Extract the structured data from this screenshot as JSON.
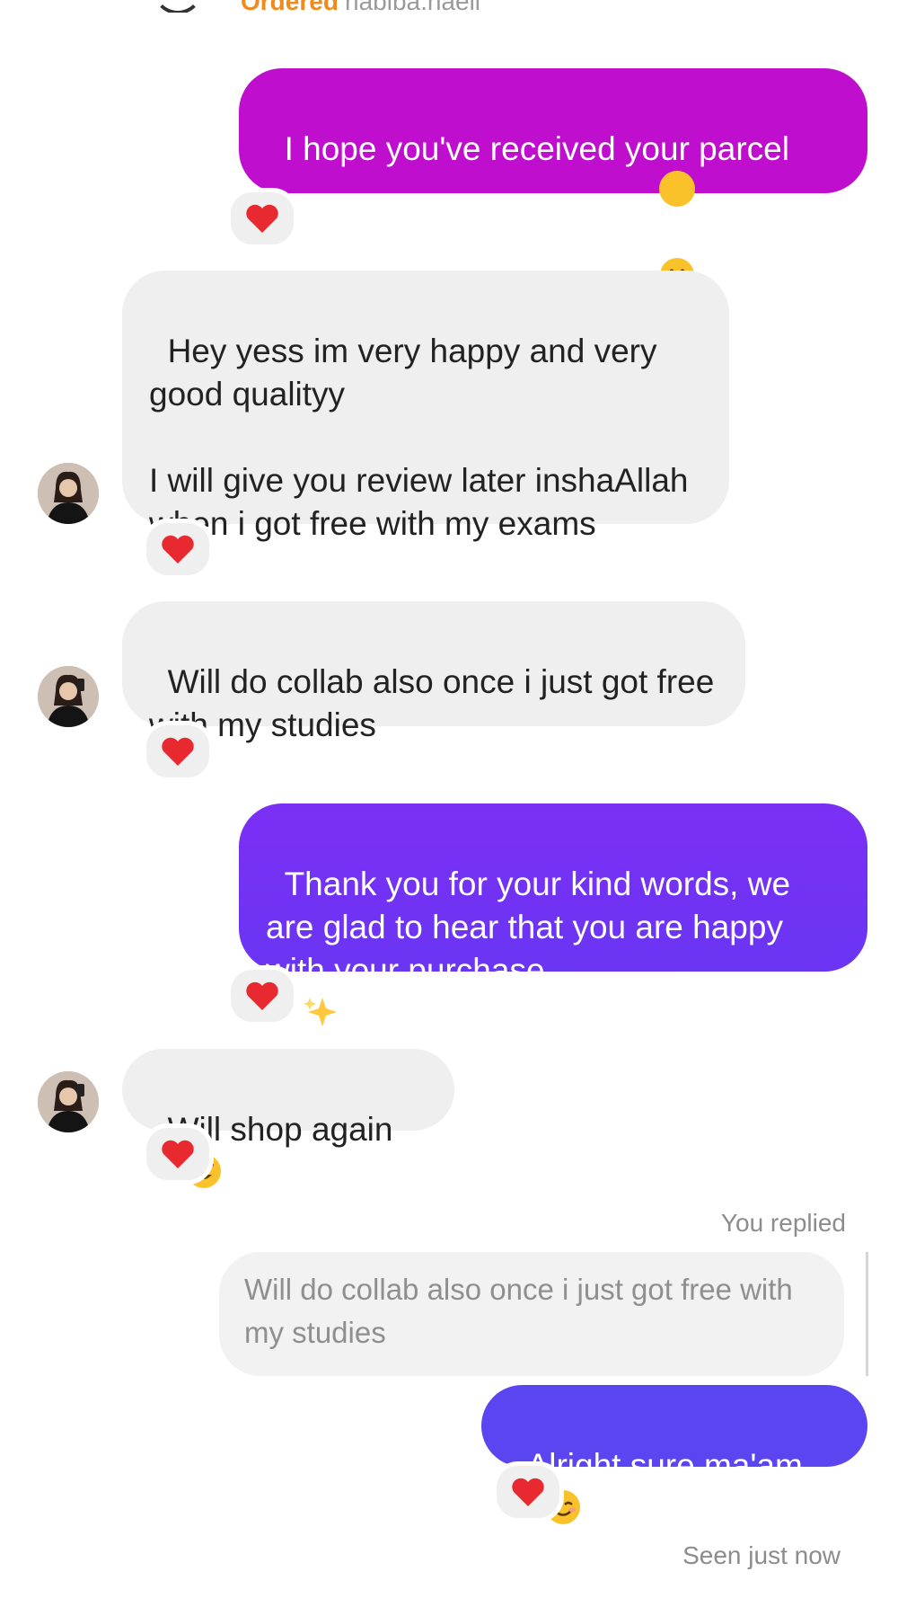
{
  "top": {
    "orange_label": "Ordered",
    "gray_label": "habiba.haeli"
  },
  "messages": [
    {
      "sender": "me",
      "text": "I hope you've received your parcel and happy with the quality!",
      "emoji": "🙂",
      "reaction": "heart"
    },
    {
      "sender": "them",
      "text": "Hey yess im very happy and very good qualityy\n\nI will give you review later inshaAllah when i got free with my exams",
      "reaction": "heart"
    },
    {
      "sender": "them",
      "text": "Will do collab also once i just got free with my studies",
      "reaction": "heart"
    },
    {
      "sender": "me",
      "text": "Thank you for your kind words, we are glad to hear that you are happy with your purchase",
      "emoji": "✨",
      "reaction": "heart"
    },
    {
      "sender": "them",
      "text": "Will shop again",
      "emoji": "😍",
      "reaction": "heart"
    },
    {
      "sender": "me",
      "text": "Alright sure ma'am",
      "emoji": "😊",
      "reaction": "heart"
    }
  ],
  "reply": {
    "label": "You replied",
    "quoted": "Will do collab also once i just got free with my studies"
  },
  "status": "Seen just now",
  "colors": {
    "bubble_1": "#c00ecf",
    "bubble_2_top": "#7b2ff5",
    "bubble_2_bottom": "#6a35f3",
    "bubble_3": "#5b45f0",
    "incoming": "#efefef",
    "heart": "#e8292f"
  },
  "icons": {
    "reaction": "heart-icon"
  }
}
